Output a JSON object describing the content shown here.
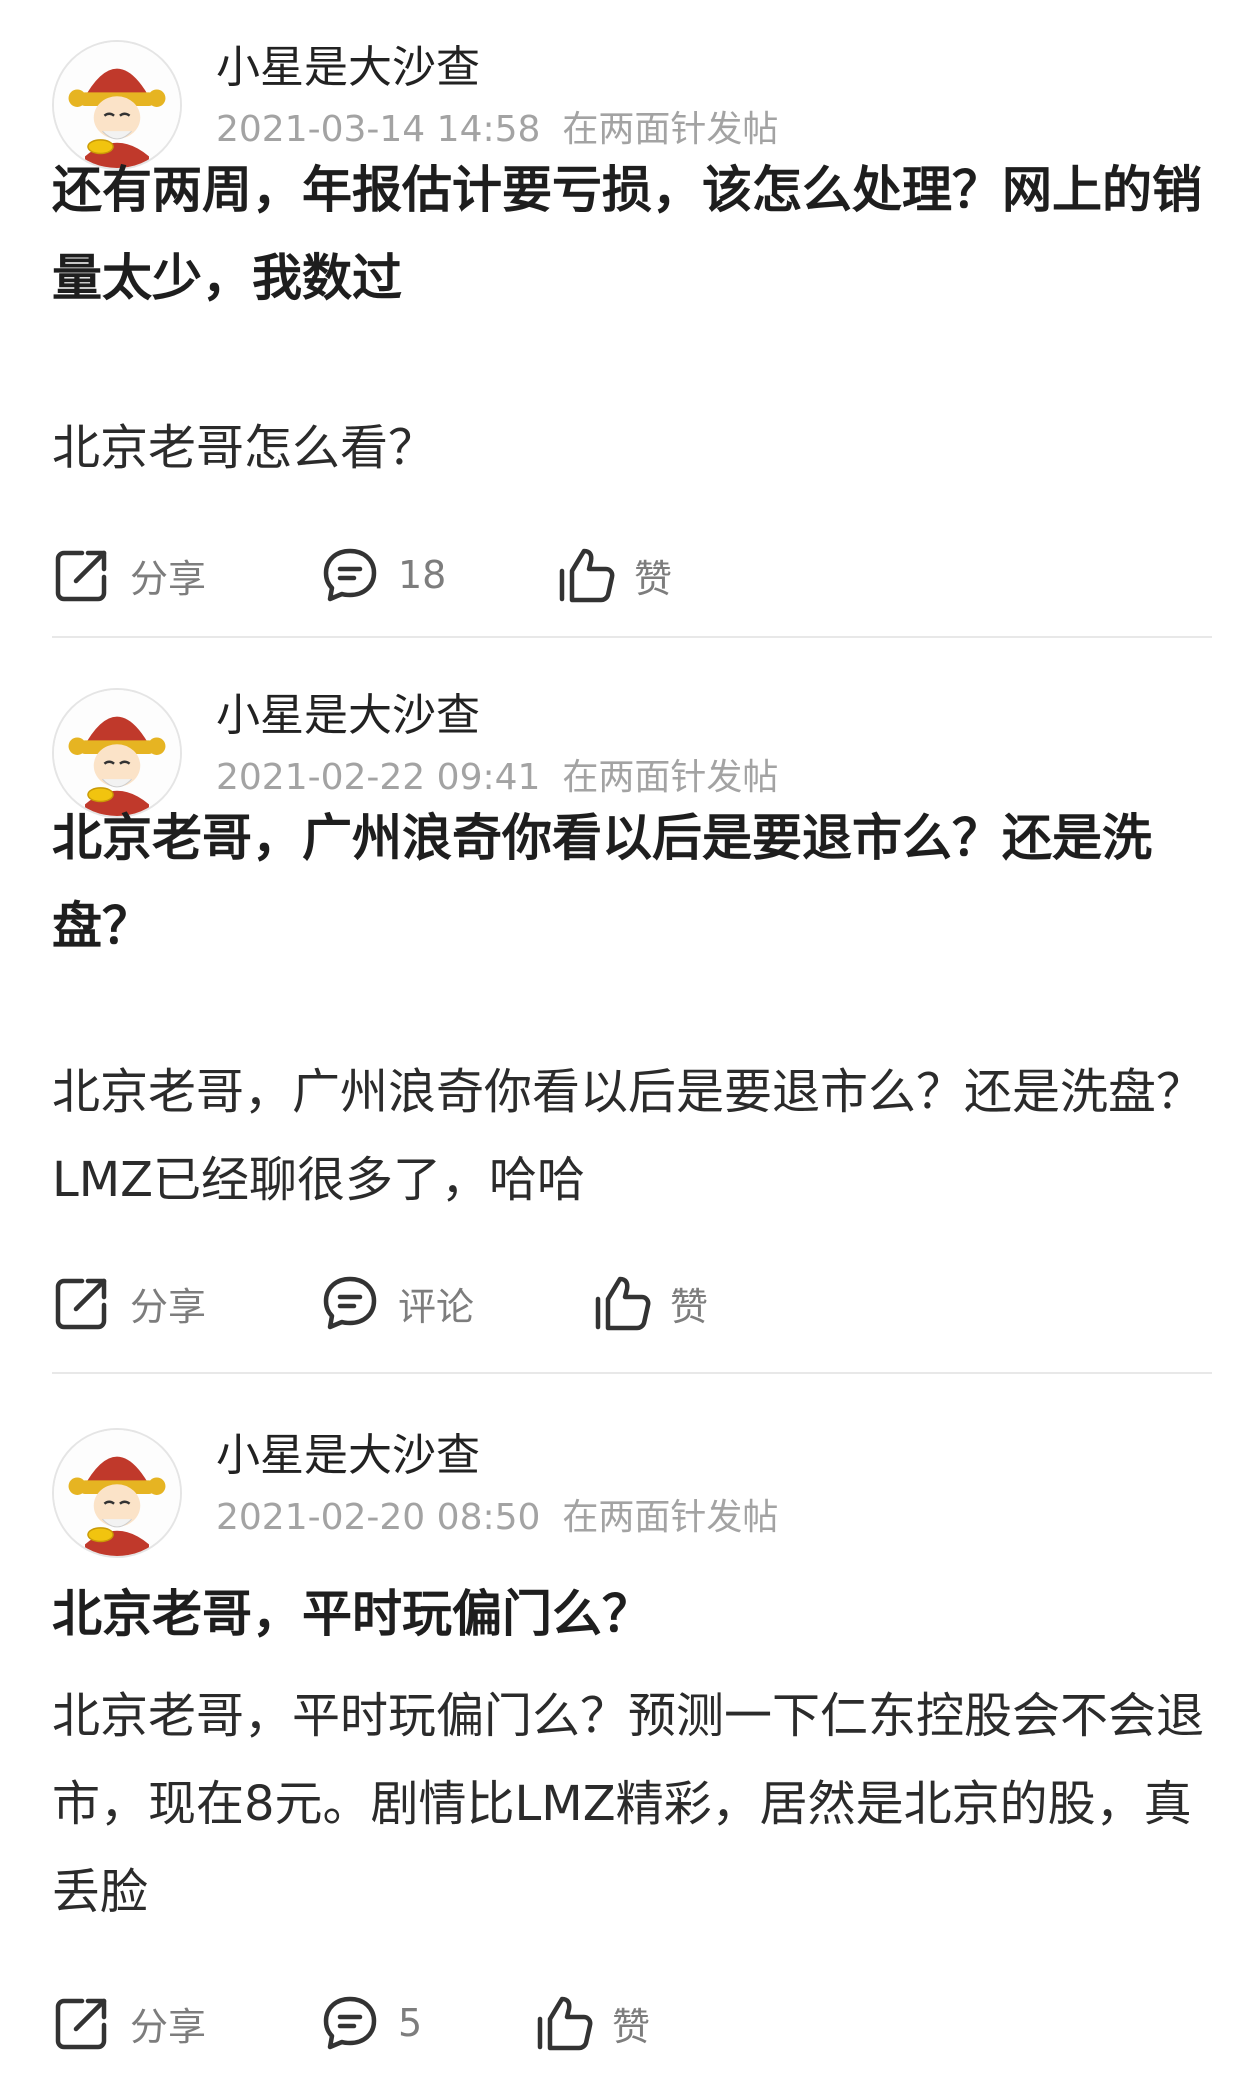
{
  "posts": [
    {
      "author": "小星是大沙查",
      "datetime": "2021-03-14 14:58",
      "source": "在两面针发帖",
      "title": "还有两周，年报估计要亏损，该怎么处理？网上的销量太少，我数过",
      "body": "北京老哥怎么看？",
      "share_label": "分享",
      "comment_label": "18",
      "like_label": "赞"
    },
    {
      "author": "小星是大沙查",
      "datetime": "2021-02-22 09:41",
      "source": "在两面针发帖",
      "title": "北京老哥，广州浪奇你看以后是要退市么？还是洗盘？",
      "body": "北京老哥，广州浪奇你看以后是要退市么？还是洗盘？LMZ已经聊很多了，哈哈",
      "share_label": "分享",
      "comment_label": "评论",
      "like_label": "赞"
    },
    {
      "author": "小星是大沙查",
      "datetime": "2021-02-20 08:50",
      "source": "在两面针发帖",
      "title": "北京老哥，平时玩偏门么？",
      "body": "北京老哥，平时玩偏门么？预测一下仁东控股会不会退市，现在8元。剧情比LMZ精彩，居然是北京的股，真丢脸",
      "share_label": "分享",
      "comment_label": "5",
      "like_label": "赞"
    }
  ],
  "icons": {
    "share": "share-icon",
    "comment": "comment-icon",
    "like": "thumbs-up-icon",
    "avatar": "cartoon-fortune-god-avatar"
  },
  "colors": {
    "text_primary": "#222222",
    "text_meta": "#a3a3a3",
    "text_action": "#7d7d7d",
    "icon": "#333333",
    "divider": "#e8e8e8"
  }
}
